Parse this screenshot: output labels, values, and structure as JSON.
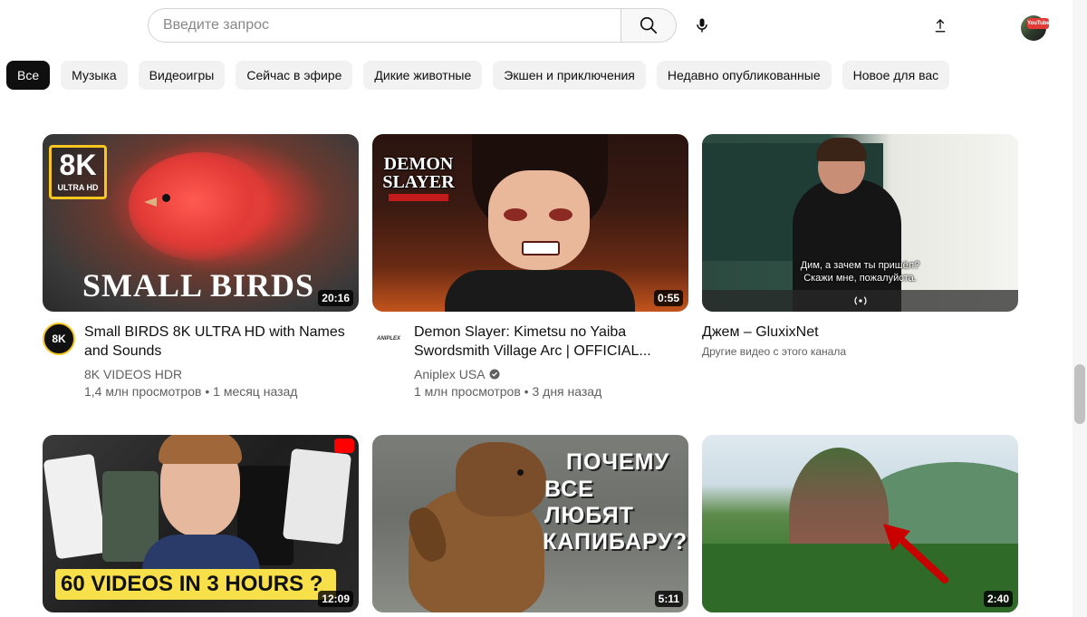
{
  "search": {
    "placeholder": "Введите запрос"
  },
  "chips": [
    "Все",
    "Музыка",
    "Видеоигры",
    "Сейчас в эфире",
    "Дикие животные",
    "Экшен и приключения",
    "Недавно опубликованные",
    "Новое для вас"
  ],
  "avatar_badge": "YouTube",
  "videos": [
    {
      "title": "Small BIRDS 8K ULTRA HD with Names and Sounds",
      "channel": "8K VIDEOS HDR",
      "views": "1,4 млн просмотров",
      "age": "1 месяц назад",
      "duration": "20:16",
      "thumb_text": "SMALL BIRDS",
      "badge_main": "8K",
      "badge_sub": "ULTRA HD",
      "avatar_text": "8K"
    },
    {
      "title": "Demon Slayer: Kimetsu no Yaiba Swordsmith Village Arc | OFFICIAL...",
      "channel": "Aniplex USA",
      "views": "1 млн просмотров",
      "age": "3 дня назад",
      "duration": "0:55",
      "logo_line1": "DEMON",
      "logo_line2": "SLAYER",
      "avatar_text": "ANIPLEX"
    },
    {
      "title": "Джем – GluxixNet",
      "channel": "Другие видео с этого канала",
      "subtitle_line1": "Дим, а зачем ты пришёл?",
      "subtitle_line2": "Скажи мне, пожалуйста."
    },
    {
      "duration": "12:09",
      "thumb_text": "60 VIDEOS IN 3 HOURS ?"
    },
    {
      "duration": "5:11",
      "thumb_line1": "ПОЧЕМУ",
      "thumb_line2": "ВСЕ ЛЮБЯТ",
      "thumb_line3": "КАПИБАРУ?"
    },
    {
      "duration": "2:40"
    }
  ],
  "colors": {
    "accent": "#0f0f0f",
    "chip_bg": "#f2f2f2",
    "secondary_text": "#606060",
    "red": "#ff0000"
  }
}
